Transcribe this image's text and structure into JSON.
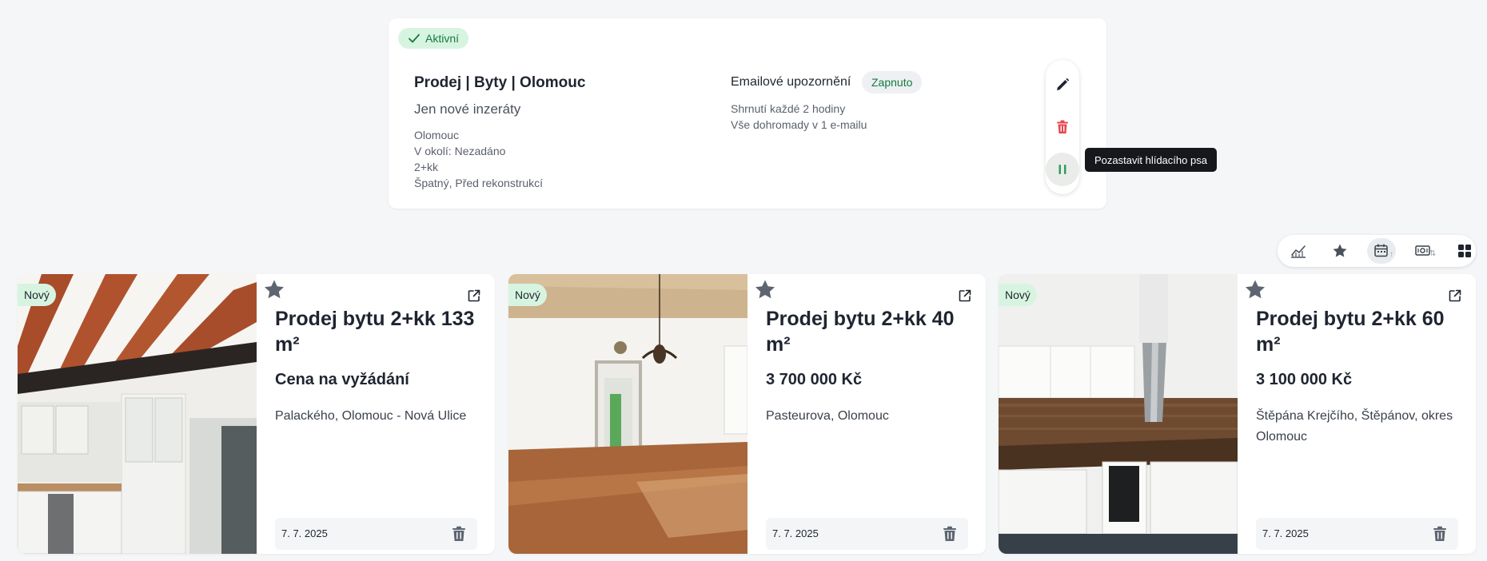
{
  "watchdog": {
    "status": "Aktivní",
    "title": "Prodej | Byty | Olomouc",
    "subtitle": "Jen nové inzeráty",
    "params": [
      "Olomouc",
      "V okolí: Nezadáno",
      "2+kk",
      "Špatný, Před rekonstrukcí"
    ],
    "email_label": "Emailové upozornění",
    "email_status": "Zapnuto",
    "email_lines": [
      "Shrnutí každé 2 hodiny",
      "Vše dohromady v 1 e-mailu"
    ],
    "actions": {
      "edit_icon": "pencil-icon",
      "delete_icon": "trash-icon",
      "pause_icon": "pause-icon"
    },
    "tooltip": "Pozastavit hlídacího psa"
  },
  "view_toolbar": {
    "icons": [
      "chart-line-icon",
      "star-icon",
      "calendar-sort-icon",
      "money-sort-icon",
      "grid-icon"
    ]
  },
  "listings": [
    {
      "badge": "Nový",
      "title": "Prodej bytu 2+kk 133 m²",
      "price": "Cena na vyžádání",
      "address": "Palackého, Olomouc - Nová Ulice",
      "date": "7. 7. 2025"
    },
    {
      "badge": "Nový",
      "title": "Prodej bytu 2+kk 40 m²",
      "price": "3 700 000 Kč",
      "address": "Pasteurova, Olomouc",
      "date": "7. 7. 2025"
    },
    {
      "badge": "Nový",
      "title": "Prodej bytu 2+kk 60 m²",
      "price": "3 100 000 Kč",
      "address": "Štěpána Krejčího, Štěpánov, okres Olomouc",
      "date": "7. 7. 2025"
    }
  ],
  "colors": {
    "accent_green": "#147a3e",
    "badge_green_bg": "#d7f4e1",
    "delete_red": "#e5484d"
  }
}
